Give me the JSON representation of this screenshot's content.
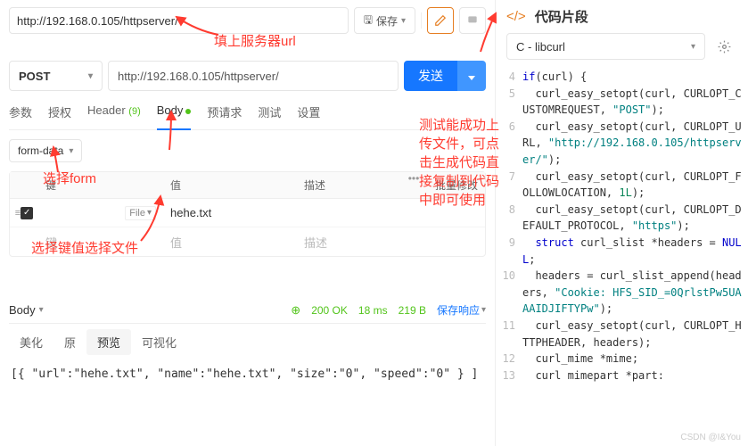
{
  "topUrl": "http://192.168.0.105/httpserver/",
  "saveLabel": "保存",
  "method": "POST",
  "reqUrl": "http://192.168.0.105/httpserver/",
  "sendLabel": "发送",
  "tabs": {
    "params": "参数",
    "auth": "授权",
    "header": "Header",
    "headerCount": "(9)",
    "body": "Body",
    "prereq": "预请求",
    "test": "测试",
    "settings": "设置"
  },
  "bodyType": "form-data",
  "table": {
    "key": "键",
    "value": "值",
    "desc": "描述",
    "bulk": "批量修改",
    "row1": {
      "keyType": "File",
      "value": "hehe.txt"
    },
    "ph": {
      "key": "键",
      "value": "值",
      "desc": "描述"
    }
  },
  "anno": {
    "url": "填上服务器url",
    "form": "选择form",
    "file": "选择键值选择文件",
    "test": "测试能成功上传文件，可点击生成代码直接复制到代码中即可使用"
  },
  "resp": {
    "bodyLabel": "Body",
    "status": "200 OK",
    "time": "18 ms",
    "size": "219 B",
    "save": "保存响应",
    "t1": "美化",
    "t2": "原",
    "t3": "预览",
    "t4": "可视化",
    "content": "[{ \"url\":\"hehe.txt\", \"name\":\"hehe.txt\", \"size\":\"0\", \"speed\":\"0\" } ]"
  },
  "snippet": {
    "title": "代码片段",
    "lang": "C - libcurl",
    "lines": [
      {
        "n": 4,
        "t": "if(curl) {"
      },
      {
        "n": 5,
        "t": "  curl_easy_setopt(curl, CURLOPT_CUSTOMREQUEST, \"POST\");"
      },
      {
        "n": 6,
        "t": "  curl_easy_setopt(curl, CURLOPT_URL, \"http://192.168.0.105/httpserver/\");"
      },
      {
        "n": 7,
        "t": "  curl_easy_setopt(curl, CURLOPT_FOLLOWLOCATION, 1L);"
      },
      {
        "n": 8,
        "t": "  curl_easy_setopt(curl, CURLOPT_DEFAULT_PROTOCOL, \"https\");"
      },
      {
        "n": 9,
        "t": "  struct curl_slist *headers = NULL;"
      },
      {
        "n": 10,
        "t": "  headers = curl_slist_append(headers, \"Cookie: HFS_SID_=0QrlstPw5UAAAIDJIFTYPw\");"
      },
      {
        "n": 11,
        "t": "  curl_easy_setopt(curl, CURLOPT_HTTPHEADER, headers);"
      },
      {
        "n": 12,
        "t": "  curl_mime *mime;"
      },
      {
        "n": 13,
        "t": "  curl mimepart *part:"
      }
    ]
  },
  "watermark": "CSDN @I&You"
}
